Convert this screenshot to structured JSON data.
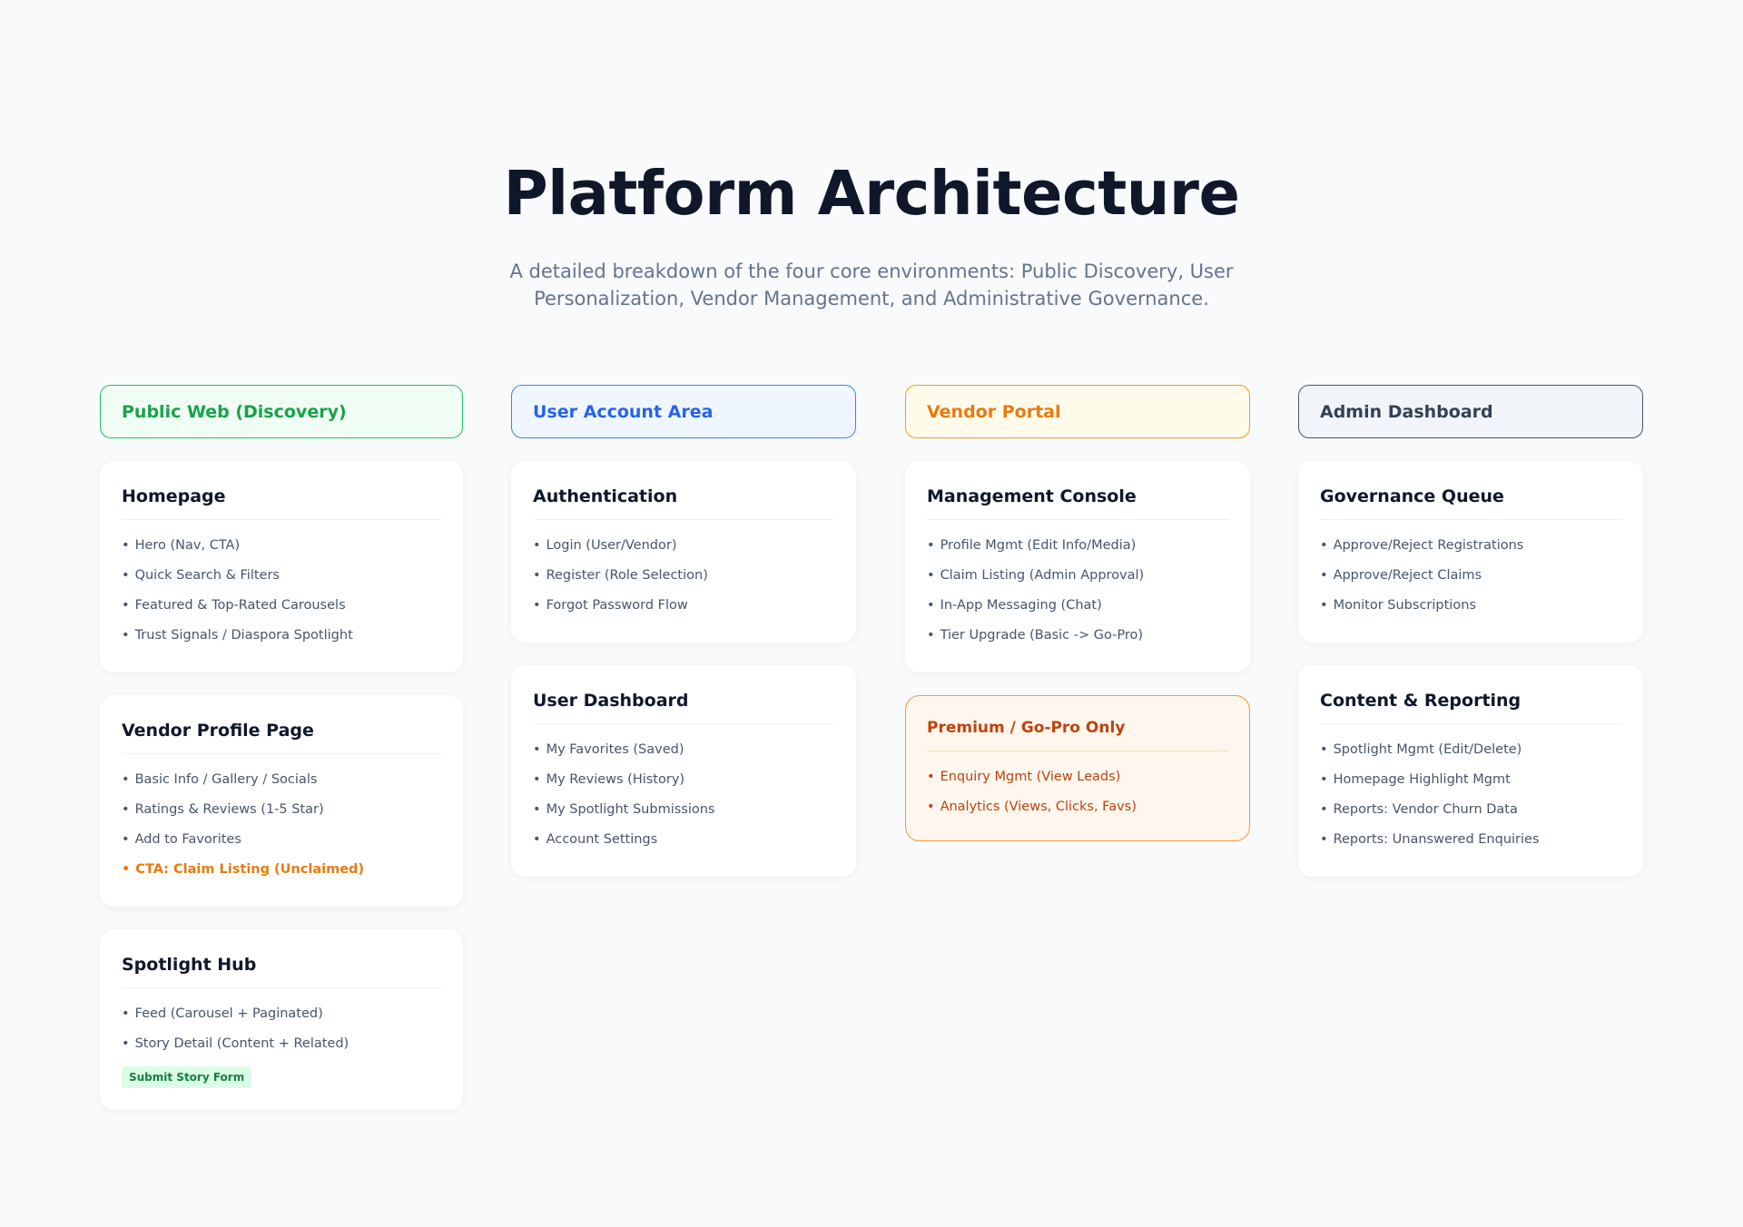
{
  "title": "Platform Architecture",
  "subtitle_line1": "A detailed breakdown of the four core environments: Public Discovery, User",
  "subtitle_line2": "Personalization, Vendor Management, and Administrative Governance.",
  "colors": {
    "public_accent": "#16a34a",
    "user_accent": "#2563eb",
    "vendor_accent": "#ea7a0c",
    "admin_accent": "#334155",
    "premium_text": "#c2410c",
    "badge_bg": "#dcfce7"
  },
  "bullet": "•",
  "columns": [
    {
      "header": "Public Web (Discovery)",
      "cards": [
        {
          "title": "Homepage",
          "items": [
            "Hero (Nav, CTA)",
            "Quick Search & Filters",
            "Featured & Top-Rated Carousels",
            "Trust Signals / Diaspora Spotlight"
          ]
        },
        {
          "title": "Vendor Profile Page",
          "items": [
            "Basic Info / Gallery / Socials",
            "Ratings & Reviews (1-5 Star)",
            "Add to Favorites",
            "CTA: Claim Listing (Unclaimed)"
          ]
        },
        {
          "title": "Spotlight Hub",
          "items": [
            "Feed (Carousel + Paginated)",
            "Story Detail (Content + Related)"
          ],
          "badge": "Submit Story Form"
        }
      ]
    },
    {
      "header": "User Account Area",
      "cards": [
        {
          "title": "Authentication",
          "items": [
            "Login (User/Vendor)",
            "Register (Role Selection)",
            "Forgot Password Flow"
          ]
        },
        {
          "title": "User Dashboard",
          "items": [
            "My Favorites (Saved)",
            "My Reviews (History)",
            "My Spotlight Submissions",
            "Account Settings"
          ]
        }
      ]
    },
    {
      "header": "Vendor Portal",
      "cards": [
        {
          "title": "Management Console",
          "items": [
            "Profile Mgmt (Edit Info/Media)",
            "Claim Listing (Admin Approval)",
            "In-App Messaging (Chat)",
            "Tier Upgrade (Basic -> Go-Pro)"
          ]
        },
        {
          "title": "Premium / Go-Pro Only",
          "items": [
            "Enquiry Mgmt (View Leads)",
            "Analytics (Views, Clicks, Favs)"
          ]
        }
      ]
    },
    {
      "header": "Admin Dashboard",
      "cards": [
        {
          "title": "Governance Queue",
          "items": [
            "Approve/Reject Registrations",
            "Approve/Reject Claims",
            "Monitor Subscriptions"
          ]
        },
        {
          "title": "Content & Reporting",
          "items": [
            "Spotlight Mgmt (Edit/Delete)",
            "Homepage Highlight Mgmt",
            "Reports: Vendor Churn Data",
            "Reports: Unanswered Enquiries"
          ]
        }
      ]
    }
  ]
}
